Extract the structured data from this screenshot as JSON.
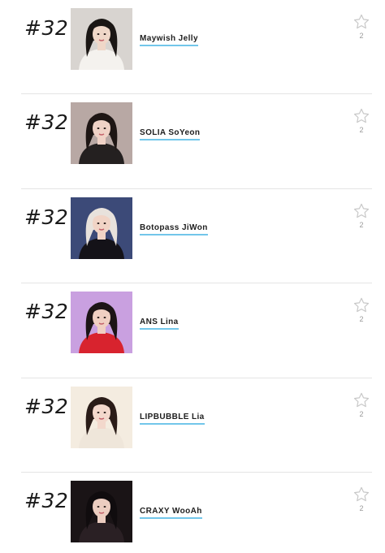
{
  "entries": [
    {
      "rank": "#32",
      "name": "Maywish Jelly",
      "votes": "2",
      "icon": "star-outline-icon",
      "photo": {
        "bg": "#d8d4d0",
        "hair": "#1a1614",
        "skin": "#efd7c8",
        "cloth": "#f4f2ee"
      }
    },
    {
      "rank": "#32",
      "name": "SOLIA SoYeon",
      "votes": "2",
      "icon": "star-outline-icon",
      "photo": {
        "bg": "#b8a8a4",
        "hair": "#1e1614",
        "skin": "#f0d2c6",
        "cloth": "#242020"
      }
    },
    {
      "rank": "#32",
      "name": "Botopass JiWon",
      "votes": "2",
      "icon": "star-outline-icon",
      "photo": {
        "bg": "#3c4a78",
        "hair": "#e8e2dc",
        "skin": "#f1d4c6",
        "cloth": "#141218"
      }
    },
    {
      "rank": "#32",
      "name": "ANS Lina",
      "votes": "2",
      "icon": "star-outline-icon",
      "photo": {
        "bg": "#c9a0e0",
        "hair": "#1c1416",
        "skin": "#f0cfc2",
        "cloth": "#d8232e"
      }
    },
    {
      "rank": "#32",
      "name": "LIPBUBBLE Lia",
      "votes": "2",
      "icon": "star-outline-icon",
      "photo": {
        "bg": "#f4ece0",
        "hair": "#2a1c18",
        "skin": "#f3d8cc",
        "cloth": "#efe6da"
      }
    },
    {
      "rank": "#32",
      "name": "CRAXY WooAh",
      "votes": "2",
      "icon": "star-outline-icon",
      "photo": {
        "bg": "#1a1416",
        "hair": "#100c0e",
        "skin": "#eccdc0",
        "cloth": "#2a2024"
      }
    }
  ],
  "colors": {
    "accent_underline": "#72c6ea",
    "divider": "#e4e4e4",
    "star_outline": "#c8c8c8",
    "count_text": "#9a9a9a"
  }
}
